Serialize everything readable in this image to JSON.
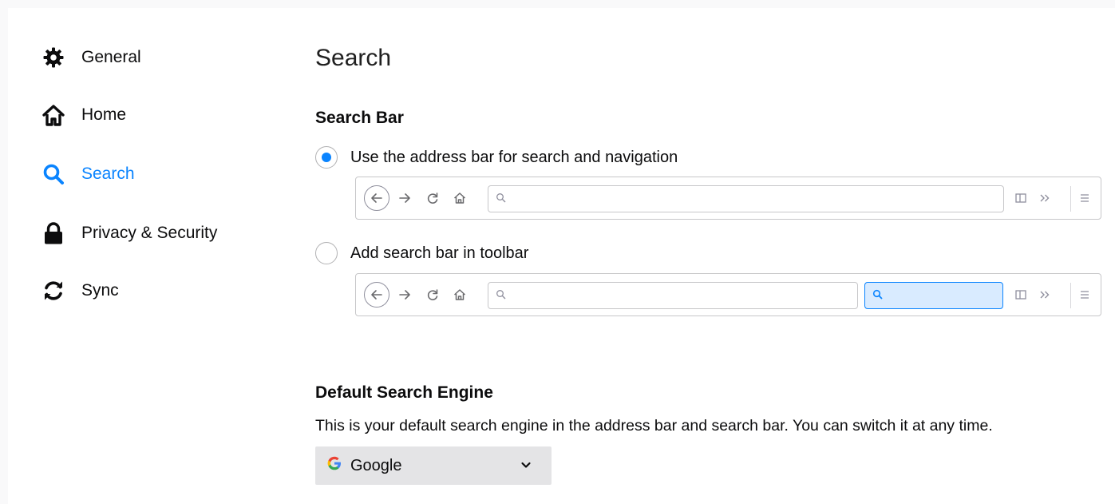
{
  "sidebar": {
    "items": [
      {
        "label": "General",
        "icon": "gear-icon",
        "selected": false
      },
      {
        "label": "Home",
        "icon": "home-icon",
        "selected": false
      },
      {
        "label": "Search",
        "icon": "search-icon",
        "selected": true
      },
      {
        "label": "Privacy & Security",
        "icon": "lock-icon",
        "selected": false
      },
      {
        "label": "Sync",
        "icon": "sync-icon",
        "selected": false
      }
    ]
  },
  "main": {
    "title": "Search",
    "search_bar": {
      "heading": "Search Bar",
      "options": [
        {
          "label": "Use the address bar for search and navigation",
          "checked": true
        },
        {
          "label": "Add search bar in toolbar",
          "checked": false
        }
      ]
    },
    "default_engine": {
      "heading": "Default Search Engine",
      "description": "This is your default search engine in the address bar and search bar. You can switch it at any time.",
      "selected": "Google",
      "logo_letter": "G"
    }
  },
  "colors": {
    "accent": "#0a84ff",
    "text": "#0c0c0d",
    "select_bg": "#e4e4e6"
  }
}
